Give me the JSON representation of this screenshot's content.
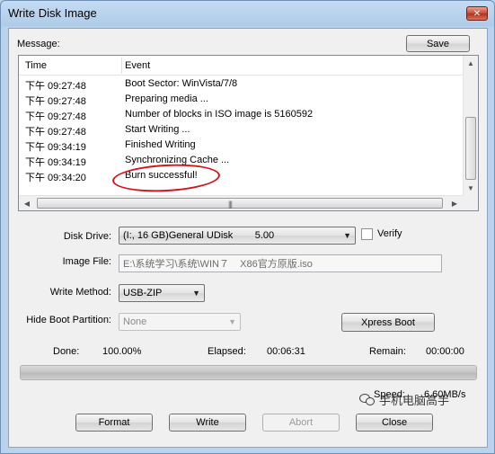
{
  "window": {
    "title": "Write Disk Image"
  },
  "message": {
    "label": "Message:",
    "save_label": "Save",
    "columns": {
      "time": "Time",
      "event": "Event"
    },
    "rows": [
      {
        "time": "下午 09:27:48",
        "event": "Boot Sector: WinVista/7/8"
      },
      {
        "time": "下午 09:27:48",
        "event": "Preparing media ..."
      },
      {
        "time": "下午 09:27:48",
        "event": "Number of blocks in ISO image is 5160592"
      },
      {
        "time": "下午 09:27:48",
        "event": "Start Writing ..."
      },
      {
        "time": "下午 09:34:19",
        "event": "Finished Writing"
      },
      {
        "time": "下午 09:34:19",
        "event": "Synchronizing Cache ..."
      },
      {
        "time": "下午 09:34:20",
        "event": "Burn successful!"
      }
    ]
  },
  "form": {
    "disk_drive_label": "Disk Drive:",
    "disk_drive_value": "(I:, 16 GB)General UDisk        5.00",
    "verify_label": "Verify",
    "image_file_label": "Image File:",
    "image_file_value": "E:\\系统学习\\系统\\WIN７    X86官方原版.iso",
    "write_method_label": "Write Method:",
    "write_method_value": "USB-ZIP",
    "hide_boot_label": "Hide Boot Partition:",
    "hide_boot_value": "None",
    "xpress_boot_label": "Xpress Boot"
  },
  "status": {
    "done_label": "Done:",
    "done_value": "100.00%",
    "done_fraction": 1.0,
    "elapsed_label": "Elapsed:",
    "elapsed_value": "00:06:31",
    "remain_label": "Remain:",
    "remain_value": "00:00:00",
    "speed_label": "Speed:",
    "speed_value": "6.60MB/s"
  },
  "buttons": {
    "format": "Format",
    "write": "Write",
    "abort": "Abort",
    "close": "Close"
  },
  "watermark": {
    "text": "手机电脑高手",
    "icon": "wechat-icon"
  },
  "colors": {
    "highlight_circle": "#d4161c",
    "title_bg": "#bcd6ee"
  }
}
